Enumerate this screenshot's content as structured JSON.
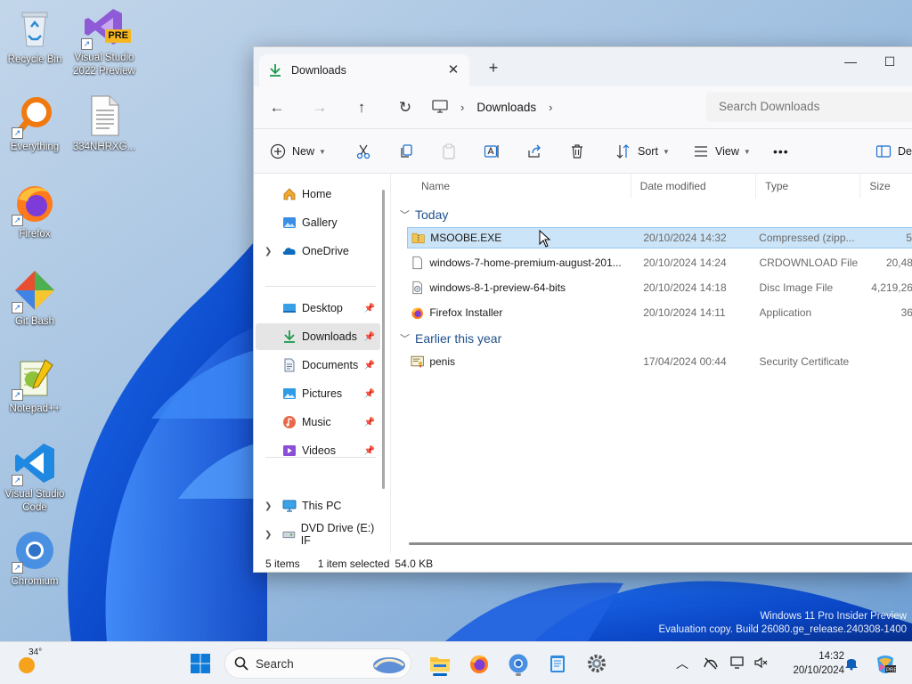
{
  "desktop": {
    "icons": [
      {
        "label": "Recycle Bin"
      },
      {
        "label": "Visual Studio 2022 Preview",
        "badge": "PRE"
      },
      {
        "label": "Everything"
      },
      {
        "label": "334NHRXG..."
      },
      {
        "label": "Firefox"
      },
      {
        "label": "Git Bash"
      },
      {
        "label": "Notepad++"
      },
      {
        "label": "Visual Studio Code"
      },
      {
        "label": "Chromium"
      }
    ],
    "watermark": {
      "line1": "Windows 11 Pro Insider Preview",
      "line2": "Evaluation copy. Build 26080.ge_release.240308-1400"
    }
  },
  "explorer": {
    "tab_title": "Downloads",
    "window_controls": {
      "minimize": "—",
      "maximize": "☐"
    },
    "address": {
      "root_icon": "pc-icon",
      "segments": [
        "Downloads"
      ]
    },
    "search_placeholder": "Search Downloads",
    "toolbar": {
      "new": "New",
      "sort": "Sort",
      "view": "View",
      "more": "•••",
      "details": "Details"
    },
    "sidebar": {
      "items": [
        {
          "label": "Home",
          "icon": "home-icon"
        },
        {
          "label": "Gallery",
          "icon": "gallery-icon"
        },
        {
          "label": "OneDrive",
          "icon": "onedrive-icon",
          "expandable": true
        },
        {
          "label": "Desktop",
          "icon": "desktop-icon",
          "pinned": true
        },
        {
          "label": "Downloads",
          "icon": "downloads-icon",
          "pinned": true,
          "selected": true
        },
        {
          "label": "Documents",
          "icon": "documents-icon",
          "pinned": true
        },
        {
          "label": "Pictures",
          "icon": "pictures-icon",
          "pinned": true
        },
        {
          "label": "Music",
          "icon": "music-icon",
          "pinned": true
        },
        {
          "label": "Videos",
          "icon": "videos-icon",
          "pinned": true
        },
        {
          "label": "This PC",
          "icon": "this-pc-icon",
          "expandable": true
        },
        {
          "label": "DVD Drive (E:) IF",
          "icon": "dvd-drive-icon",
          "expandable": true
        }
      ]
    },
    "columns": {
      "name": "Name",
      "date": "Date modified",
      "type": "Type",
      "size": "Size"
    },
    "groups": [
      {
        "label": "Today",
        "files": [
          {
            "name": "MSOOBE.EXE",
            "date": "20/10/2024 14:32",
            "type": "Compressed (zipp...",
            "size": "5",
            "icon": "zip-folder-icon",
            "selected": true
          },
          {
            "name": "windows-7-home-premium-august-201...",
            "date": "20/10/2024 14:24",
            "type": "CRDOWNLOAD File",
            "size": "20,48",
            "icon": "blank-file-icon"
          },
          {
            "name": "windows-8-1-preview-64-bits",
            "date": "20/10/2024 14:18",
            "type": "Disc Image File",
            "size": "4,219,26",
            "icon": "disc-image-icon"
          },
          {
            "name": "Firefox Installer",
            "date": "20/10/2024 14:11",
            "type": "Application",
            "size": "36",
            "icon": "firefox-installer-icon"
          }
        ]
      },
      {
        "label": "Earlier this year",
        "files": [
          {
            "name": "penis",
            "date": "17/04/2024 00:44",
            "type": "Security Certificate",
            "size": "",
            "icon": "certificate-icon"
          }
        ]
      }
    ],
    "status": {
      "items": "5 items",
      "selected": "1 item selected",
      "size": "54.0 KB"
    }
  },
  "taskbar": {
    "weather_temp": "34°",
    "search_label": "Search",
    "time": "14:32",
    "date": "20/10/2024"
  }
}
